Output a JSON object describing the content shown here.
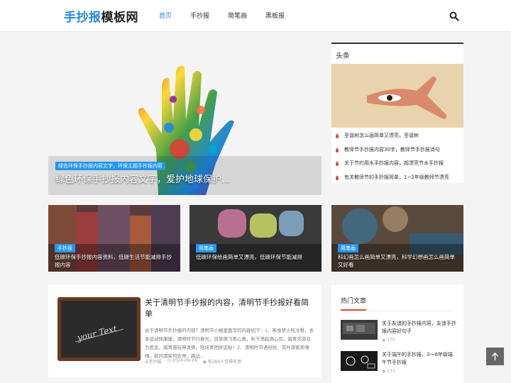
{
  "header": {
    "logo_part1": "手抄报",
    "logo_part2": "模板网",
    "nav": [
      "首页",
      "手抄报",
      "简笔画",
      "黑板报"
    ],
    "search_icon": "search-icon"
  },
  "hero": {
    "tag": "绿色环保手抄报内容文字，环保主题手抄报内容",
    "title": "绿色环保手抄报内容文字，爱护地球保护..."
  },
  "sidebar_top": {
    "heading": "头条",
    "items": [
      "圣诞树怎么画简单又漂亮，圣诞树",
      "教师节手抄报内容30字，教师节手抄报诗句",
      "关于节约用水手抄报内容，超漂亮节水手抄报",
      "有关教师节的手抄报简单，1~2年级教师节漂亮"
    ]
  },
  "cards": [
    {
      "tag": "手抄报",
      "text": "低碳环保手抄报内容资料，低碳生活节能减排手抄报内容"
    },
    {
      "tag": "简笔画",
      "text": "低碳环保绘画简单又漂亮，低碳环保节能减排"
    },
    {
      "tag": "简笔画",
      "text": "科幻画怎么画简单又漂亮，科学幻想画怎么画简单又好看"
    }
  ],
  "article": {
    "thumb_text": "your Text",
    "title": "关于清明节手抄报的内容，清明节手抄报好看简单",
    "desc": "关于清明节手抄报的内容？清明节小报里面写的内容如下：1、寒食禁火吃冷餐，多多运动体康健，清明时节行春光，风筝放飞美心意，秋千荡起满心欢，踏青郊游且为思念，踏青游玩神清爽，吃块青团好运粘！2、清明时节语纷纷，郊外游客笑嘻嘻，欲问酒家何处停，路边...",
    "category": "手抄报",
    "date": "2024-09-24",
    "views": "有289人觉得有用"
  },
  "hot": {
    "heading": "热门文章",
    "items": [
      {
        "title": "关于友谊的手抄报内容，友谊手抄报内容好句子",
        "views": "170"
      },
      {
        "title": "关于端午的手抄报，3一6年级端午节手抄报",
        "views": "233"
      }
    ]
  },
  "colors": {
    "accent": "#1e88e5",
    "tag": "#2196f3",
    "hot_underline": "#e74c3c"
  }
}
